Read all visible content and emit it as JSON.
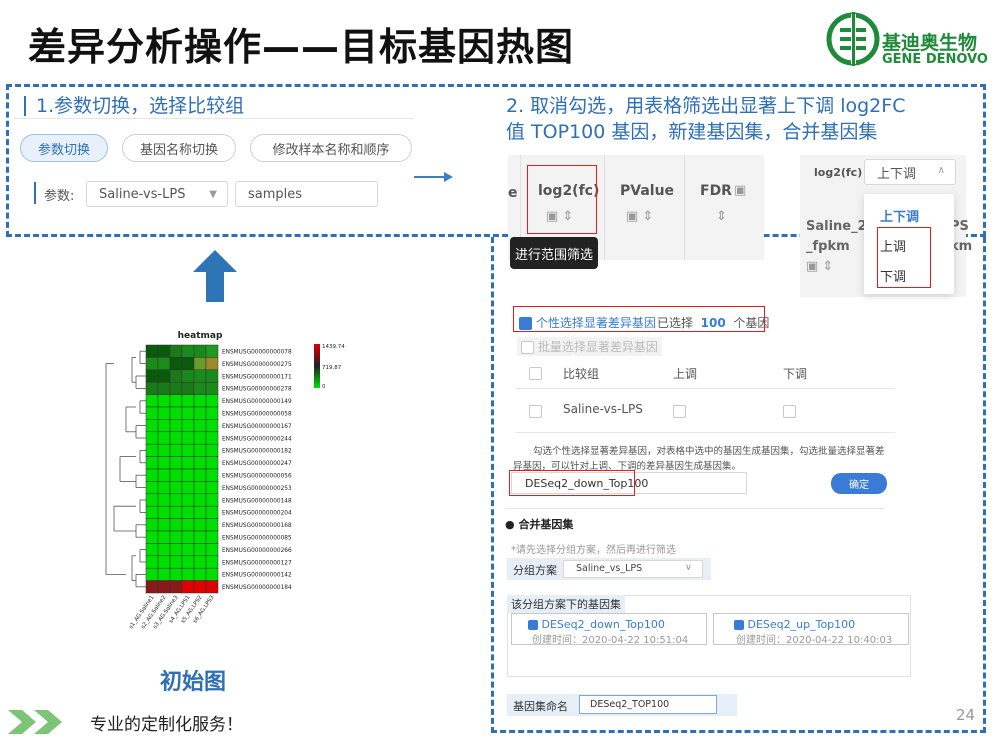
{
  "title": "差异分析操作——目标基因热图",
  "logo": {
    "cn": "基迪奥生物",
    "en": "GENE DENOVO"
  },
  "step1": {
    "title": "1.参数切换，选择比较组",
    "buttons": [
      "参数切换",
      "基因名称切换",
      "修改样本名称和顺序"
    ],
    "param_label": "参数:",
    "select1": "Saline-vs-LPS",
    "select2": "samples"
  },
  "step2": {
    "line1": "2. 取消勾选，用表格筛选出显著上下调  log2FC",
    "line2": "值 TOP100 基因，新建基因集，合并基因集"
  },
  "table_shot": {
    "col_partial": "e",
    "col_log2fc": "log2(fc)",
    "col_pvalue": "PValue",
    "col_fdr": "FDR",
    "tooltip": "进行范围筛选",
    "filter_label": "log2(fc)",
    "filter_value": "上下调",
    "options": [
      "上下调",
      "上调",
      "下调"
    ],
    "col_saline": [
      "Saline_2",
      "_fpkm"
    ],
    "col_cut": [
      "PS",
      "km"
    ]
  },
  "geneset": {
    "select_individual": "个性选择显著差异基因",
    "selected_prefix": "已选择",
    "selected_count": "100",
    "selected_suffix": "个基因",
    "batch": "批量选择显著差异基因",
    "headers": [
      "比较组",
      "上调",
      "下调"
    ],
    "row": "Saline-vs-LPS",
    "desc": "勾选个性选择显著差异基因，对表格中选中的基因生成基因集，勾选批量选择显著差异基因，可以针对上调、下调的差异基因生成基因集。",
    "name_value": "DESeq2_down_Top100",
    "confirm": "确定",
    "merge_title": "合并基因集",
    "merge_hint": "*请先选择分组方案，然后再进行筛选",
    "group_label": "分组方案",
    "group_value": "Saline_vs_LPS",
    "sets_label": "该分组方案下的基因集",
    "sets": [
      {
        "name": "DESeq2_down_Top100",
        "time": "创建时间：2020-04-22 10:51:04"
      },
      {
        "name": "DESeq2_up_Top100",
        "time": "创建时间：2020-04-22 10:40:03"
      }
    ],
    "setname_label": "基因集命名",
    "setname_value": "DESeq2_TOP100"
  },
  "heatmap": {
    "title": "heatmap",
    "genes": [
      "ENSMUSG00000000078",
      "ENSMUSG00000000275",
      "ENSMUSG00000000171",
      "ENSMUSG00000000278",
      "ENSMUSG00000000149",
      "ENSMUSG00000000058",
      "ENSMUSG00000000167",
      "ENSMUSG00000000244",
      "ENSMUSG00000000182",
      "ENSMUSG00000000247",
      "ENSMUSG00000000056",
      "ENSMUSG00000000253",
      "ENSMUSG00000000148",
      "ENSMUSG00000000204",
      "ENSMUSG00000000168",
      "ENSMUSG00000000085",
      "ENSMUSG00000000266",
      "ENSMUSG00000000127",
      "ENSMUSG00000000142",
      "ENSMUSG00000000184"
    ],
    "samples": [
      "s1_AG.Saline1",
      "s2_AG.Saline2",
      "s3_AG.Saline3",
      "s4_AG.LPS1",
      "s5_AG.LPS2",
      "s6_AG.LPS3"
    ],
    "scale": [
      "1439.74",
      "719.87",
      "0"
    ],
    "caption": "初始图"
  },
  "footer": {
    "slogan": "专业的定制化服务！",
    "page": "24"
  },
  "colors": {
    "accent": "#2f6fb5",
    "red": "#e01e1e",
    "green": "#1f8a3a"
  }
}
